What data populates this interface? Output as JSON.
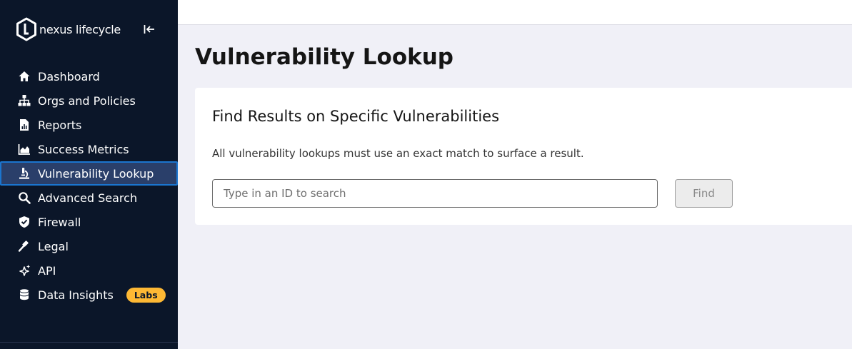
{
  "brand": {
    "name": "nexus lifecycle",
    "logo_icon": "nexus-hexagon-logo"
  },
  "sidebar": {
    "collapse_icon": "collapse-left-icon",
    "items": [
      {
        "label": "Dashboard",
        "icon": "home-icon"
      },
      {
        "label": "Orgs and Policies",
        "icon": "org-hierarchy-icon"
      },
      {
        "label": "Reports",
        "icon": "report-icon"
      },
      {
        "label": "Success Metrics",
        "icon": "area-chart-icon"
      },
      {
        "label": "Vulnerability Lookup",
        "icon": "microscope-icon",
        "active": true
      },
      {
        "label": "Advanced Search",
        "icon": "search-icon"
      },
      {
        "label": "Firewall",
        "icon": "shield-check-icon"
      },
      {
        "label": "Legal",
        "icon": "gavel-icon"
      },
      {
        "label": "API",
        "icon": "sparkle-icon"
      },
      {
        "label": "Data Insights",
        "icon": "database-icon",
        "badge": "Labs"
      }
    ]
  },
  "main": {
    "title": "Vulnerability Lookup",
    "card": {
      "title": "Find Results on Specific Vulnerabilities",
      "description": "All vulnerability lookups must use an exact match to surface a result.",
      "search": {
        "placeholder": "Type in an ID to search",
        "value": ""
      },
      "find_label": "Find"
    }
  },
  "colors": {
    "sidebar_bg": "#0b1629",
    "active_item_bg": "#2a3f6a",
    "active_item_border": "#1b75cf",
    "badge_bg": "#fdb834",
    "page_bg": "#f0f0f7"
  }
}
